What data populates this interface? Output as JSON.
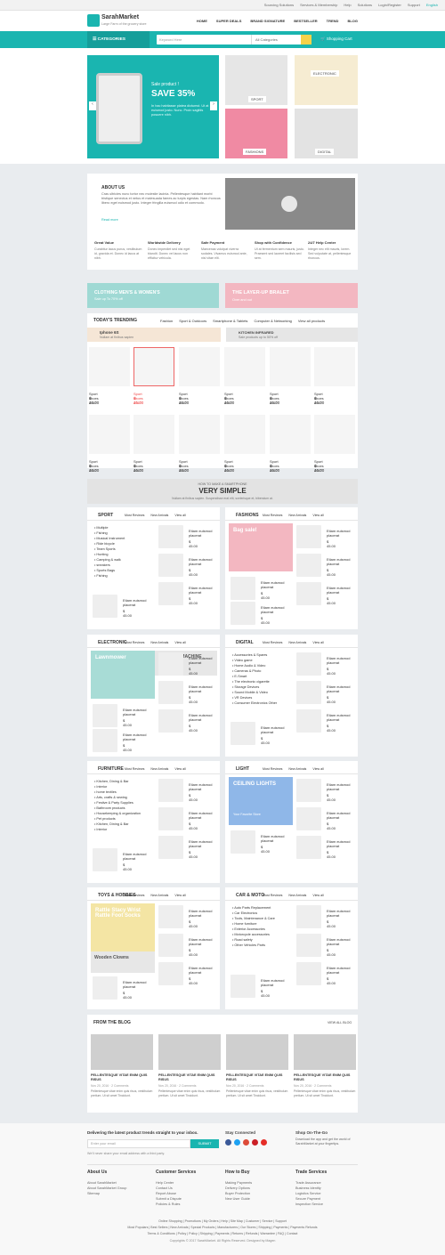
{
  "topbar": {
    "links": [
      "Sourcing Solutions",
      "Services & Membership",
      "Help",
      "Solutions",
      "Login/Register",
      "Support",
      "English"
    ]
  },
  "brand": {
    "name": "SarahMarket",
    "tagline": "Large Farm of the grocery store"
  },
  "nav": [
    "HOME",
    "SUPER DEALS",
    "BRAND SIGNATURE",
    "BESTSELLER",
    "TREND",
    "BLOG"
  ],
  "bar": {
    "categories": "CATEGORIES",
    "search_placeholder": "Keyword Here",
    "all_categories": "All Categories",
    "cart": "Shopping Cart"
  },
  "hero": {
    "title_small": "Sale product !",
    "title": "SAVE 35%",
    "desc": "In hac habitasse platea dictumst. Ut at euismod justo. Nunc. Proin sagittis posuere nibh."
  },
  "hero_tiles": [
    "SPORT",
    "ELECTRONIC",
    "FASHIONS",
    "DIGITAL"
  ],
  "about": {
    "title": "ABOUT US",
    "text": "Cras ultricies nunc tortor nec molestie lacinia. Pellentesque habitant morbi tristique senectus et netus et malesuada fames ac turpis egestas. Nam rhoncus libero eget euismod justo. Integer fringilla euismod odio et commodo.",
    "link": "Read more"
  },
  "features": [
    {
      "title": "Great Value",
      "text": "Curabitur lacus purus, vestibulum id, gravida et. Donec id lacus at nibh."
    },
    {
      "title": "Worldwide Delivery",
      "text": "Donec imperdiet sed nisi eget blandit. Donec vel lacus non efficitur vehicula."
    },
    {
      "title": "Safe Payment",
      "text": "Maecenas volutpat viverra sodales. Vivamus euismod ante, nisl vitae elit."
    },
    {
      "title": "Shop with Confidence",
      "text": "Ut at fermentum sem mauris, justo. Praesent sed laoreet facilisis sed sem."
    },
    {
      "title": "24/7 Help Center",
      "text": "Integer nec elit mauris, lorem. Sed vulputate at, pellentesque rhoncus."
    }
  ],
  "promo": {
    "left": "CLOTHING MEN'S & WOMEN'S",
    "left_sub": "Sale up To 70% off",
    "right": "THE LAYER-UP BRALET",
    "right_sub": "Over and out"
  },
  "trending": {
    "title": "TODAY'S TRENDING",
    "tabs": [
      "Fashion",
      "Sport & Outdoors",
      "Smartphone & Tablets",
      "Computer & Networking"
    ],
    "view_all": "View all products",
    "banner1": "Iphone 6S",
    "banner1_sub": "Nullam at finibus sapien",
    "banner2": "KITCHEN INFRARED",
    "banner2_sub": "Sale products up to 50% off"
  },
  "trend_products": [
    {
      "name": "Sport shoes 2017",
      "price": "$ 46.00"
    },
    {
      "name": "Sport shoes 2017",
      "price": "$ 45.00"
    },
    {
      "name": "Sport shoes 2017",
      "price": "$ 46.00"
    },
    {
      "name": "Sport shoes 2017",
      "price": "$ 46.00"
    },
    {
      "name": "Sport shoes 2017",
      "price": "$ 46.00"
    },
    {
      "name": "Sport shoes 2017",
      "price": "$ 46.00"
    },
    {
      "name": "Sport shoes 2017",
      "price": "$ 46.00"
    },
    {
      "name": "Sport shoes 2017",
      "price": "$ 46.00"
    },
    {
      "name": "Sport shoes 2017",
      "price": "$ 46.00"
    },
    {
      "name": "Sport shoes 2017",
      "price": "$ 46.00"
    },
    {
      "name": "Sport shoes 2017",
      "price": "$ 46.00"
    },
    {
      "name": "Sport shoes 2017",
      "price": "$ 46.00"
    }
  ],
  "smart": {
    "small": "HOW TO MAKE A SMARTPHONE",
    "big": "VERY SIMPLE",
    "sub": "Nullam at finibus sapien. Suspendisse erat elit, scelerisque et, bibendum at."
  },
  "cat_tabs": [
    "Most Reviews",
    "New Arrivals",
    "View all"
  ],
  "blocks": [
    {
      "title": "SPORT",
      "list": [
        "Multiple",
        "Fishing",
        "Musical Instrument",
        "Ride bicycle",
        "Team Sports",
        "Hunting",
        "Camping & walk",
        "sneakers",
        "Sports Bags",
        "Fishing"
      ]
    },
    {
      "title": "FASHIONS",
      "banner": "Bag sale!"
    },
    {
      "title": "ELECTRONIC",
      "banner": "Lawnmower",
      "banner2": "WASHING MACHINE"
    },
    {
      "title": "DIGITAL",
      "list": [
        "Accessories & Spares",
        "Video game",
        "Home Audio & Video",
        "Cameras & Photo",
        "E-Smart",
        "The electronic cigarette",
        "Storage Devices",
        "Sound Mobile & Video",
        "VR Devices",
        "Consumer Electronics Other"
      ]
    },
    {
      "title": "FURNITURE",
      "list": [
        "Kitchen, Dining & Bar",
        "Interior",
        "home textiles",
        "Arts, crafts & sewing",
        "Festive & Party Supplies",
        "Bathroom products",
        "Housekeeping & organization",
        "Pet products",
        "Kitchen, Dining & Bar",
        "Interior"
      ]
    },
    {
      "title": "LIGHT",
      "banner": "CEILING LIGHTS",
      "banner_sub": "Your Favorite Store"
    },
    {
      "title": "TOYS & HOBBIES",
      "banner": "Rattle Stacy Wrist Rattle Foot Socks",
      "banner2": "Wooden Clowns"
    },
    {
      "title": "CAR & MOTO",
      "list": [
        "Auto Parts Replacement",
        "Car Electronics",
        "Tools, Maintenance & Care",
        "Home furniture",
        "Exterior Accessories",
        "Motorcycle accessories",
        "Road safety",
        "Other Vehicles Parts"
      ]
    }
  ],
  "card": {
    "title": "Etiam euismod placerat",
    "price": "$ 45.00"
  },
  "blog": {
    "title": "FROM THE BLOG",
    "view_all": "VIEW ALL BLOG",
    "posts": [
      {
        "title": "PELLENTESQUE VITAE ENIM QUIS RISUS",
        "meta": "Nov 20, 2016 · 2 Comments",
        "text": "Pellentesque vitae enim quis risus, vestibulum pretium. Ut sit amet Tincidunt."
      },
      {
        "title": "PELLENTESQUE VITAE ENIM QUIS RISUS",
        "meta": "Nov 20, 2016 · 2 Comments",
        "text": "Pellentesque vitae enim quis risus, vestibulum pretium. Ut sit amet Tincidunt."
      },
      {
        "title": "PELLENTESQUE VITAE ENIM QUIS RISUS",
        "meta": "Nov 20, 2016 · 2 Comments",
        "text": "Pellentesque vitae enim quis risus, vestibulum pretium. Ut sit amet Tincidunt."
      },
      {
        "title": "PELLENTESQUE VITAE ENIM QUIS RISUS",
        "meta": "Nov 20, 2016 · 2 Comments",
        "text": "Pellentesque vitae enim quis risus, vestibulum pretium. Ut sit amet Tincidunt."
      }
    ]
  },
  "newsletter": {
    "title": "Delivering the latest product trends straight to your inbox.",
    "placeholder": "Enter your email",
    "button": "SUBMIT",
    "note": "We'll never share your email address with a third party.",
    "stay": "Stay Connected",
    "onthego": "Shop On-The-Go",
    "onthego_text": "Download the app and get the world of SarahMarket at your fingertips."
  },
  "footer_cols": [
    {
      "title": "About Us",
      "items": [
        "About SarahMarket",
        "About SarahMarket Group",
        "Sitemap"
      ]
    },
    {
      "title": "Customer Services",
      "items": [
        "Help Center",
        "Contact Us",
        "Report Abuse",
        "Submit a Dispute",
        "Policies & Rules"
      ]
    },
    {
      "title": "How to Buy",
      "items": [
        "Making Payments",
        "Delivery Options",
        "Buyer Protection",
        "New User Guide"
      ]
    },
    {
      "title": "Trade Services",
      "items": [
        "Trade Assurance",
        "Business Identity",
        "Logistics Service",
        "Secure Payment",
        "Inspection Service"
      ]
    }
  ],
  "footer_links": "Online Shopping | Promotions | My Orders | Help | Site Map | Customer | Service | Support",
  "footer_links2": "Most Populars | Best Sellers | New Arrivals | Special Products | Manufacturers | Our Stores | Shipping | Payments | Payments Refunds",
  "footer_links3": "Terms & Conditions | Policy | Policy | Shipping | Payments | Returns | Refunds | Warrantee | FAQ | Contact",
  "copyright": "Copyrights © 2017 SarahMarket. All Rights Reserved. Designed by Magen",
  "colors": {
    "accent": "#1ab5b0",
    "yellow": "#f6d24a",
    "pink": "#f08aa3"
  }
}
